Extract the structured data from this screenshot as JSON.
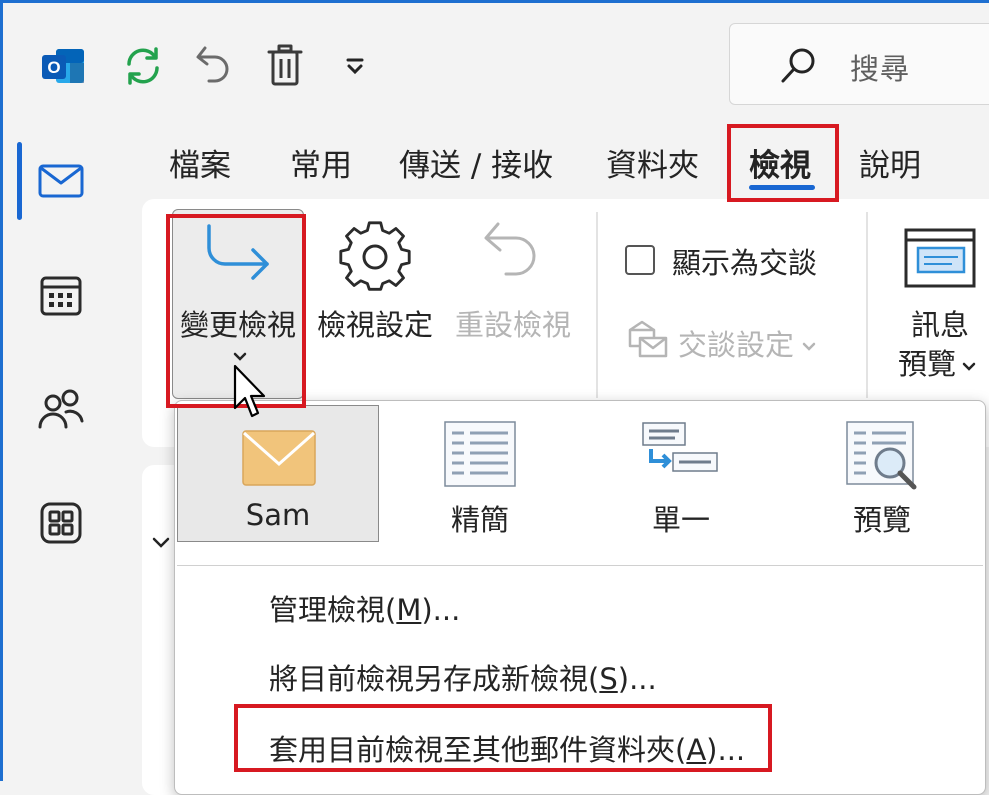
{
  "search": {
    "placeholder": "搜尋"
  },
  "tabs": [
    {
      "label": "檔案"
    },
    {
      "label": "常用"
    },
    {
      "label": "傳送 / 接收"
    },
    {
      "label": "資料夾"
    },
    {
      "label": "檢視"
    },
    {
      "label": "說明"
    }
  ],
  "ribbon": {
    "change_view": "變更檢視",
    "view_settings": "檢視設定",
    "reset_view": "重設檢視",
    "show_as_conversations": "顯示為交談",
    "conversation_settings": "交談設定",
    "message_preview_line1": "訊息",
    "message_preview_line2": "預覽"
  },
  "gallery": [
    {
      "label": "Sam"
    },
    {
      "label": "精簡"
    },
    {
      "label": "單一"
    },
    {
      "label": "預覽"
    }
  ],
  "menu": {
    "manage_prefix": "管理檢視(",
    "manage_key": "M",
    "manage_suffix": ")...",
    "saveas_prefix": "將目前檢視另存成新檢視(",
    "saveas_key": "S",
    "saveas_suffix": ")...",
    "apply_prefix": "套用目前檢視至其他郵件資料夾(",
    "apply_key": "A",
    "apply_suffix": ")..."
  },
  "icons": {
    "outlook": "outlook-logo-icon",
    "sync": "sync-icon",
    "undo": "undo-icon",
    "delete": "trash-icon",
    "customize": "chevron-down-icon",
    "search": "search-icon",
    "mail": "mail-icon",
    "calendar": "calendar-icon",
    "people": "people-icon",
    "apps": "apps-icon"
  },
  "colors": {
    "accent": "#1967d2",
    "highlight_box": "#d71921",
    "sync_green": "#23a24d"
  }
}
